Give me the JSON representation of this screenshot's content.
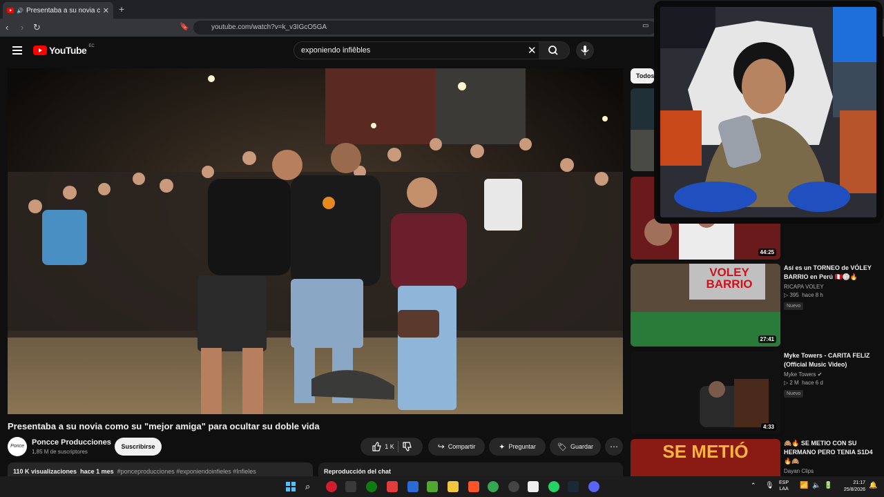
{
  "browser": {
    "tab_title": "Presentaba a su novia como su \"mejor amiga\" para ocultar su doble vida",
    "url": "youtube.com/watch?v=k_v3IGcO5GA"
  },
  "youtube": {
    "logo_text": "YouTube",
    "country_code": "EC",
    "search_query": "exponiendo infiêbles"
  },
  "video": {
    "title": "Presentaba a su novia como su \"mejor amiga\" para ocultar su doble vida",
    "channel_name": "Poncce Producciones",
    "channel_avatar_text": "Ponce",
    "subscribers": "1,85 M de suscriptores",
    "subscribe_label": "Suscribirse",
    "likes": "1 K",
    "share_label": "Compartir",
    "ask_label": "Preguntar",
    "save_label": "Guardar",
    "views": "110 K visualizaciones",
    "posted": "hace 1 mes",
    "hashtags": "#ponceproducciones #exponiendoinfieles #Infieles",
    "chat_replay_label": "Reproducción del chat"
  },
  "sidebar": {
    "filter_label": "Todos",
    "items": [
      {
        "duration": "44:25"
      },
      {
        "title": "Así es un TORNEO de VÓLEY BARRIO en Perú 🇵🇪🏐🔥",
        "channel": "RICAPA VOLEY",
        "views": "▷ 395",
        "age": "hace 8 h",
        "badge": "Nuevo",
        "duration": "27:41",
        "thumb_text": "VOLEY BARRIO"
      },
      {
        "title": "Myke Towers - CARITA FELIZ (Official Music Video)",
        "channel": "Myke Towers ✔",
        "views": "▷ 2 M",
        "age": "hace 6 d",
        "badge": "Nuevo",
        "duration": "4:33"
      },
      {
        "title": "🙈🔥 SE METIO CON SU HERMANO PERO TENIA S1D4 🔥🙈",
        "channel": "Dayan Clips",
        "thumb_text": "SE METIÓ"
      }
    ]
  },
  "taskbar": {
    "lang": "ESP",
    "lang2": "LAA",
    "time": "21:17",
    "date": "25/8/2026"
  }
}
